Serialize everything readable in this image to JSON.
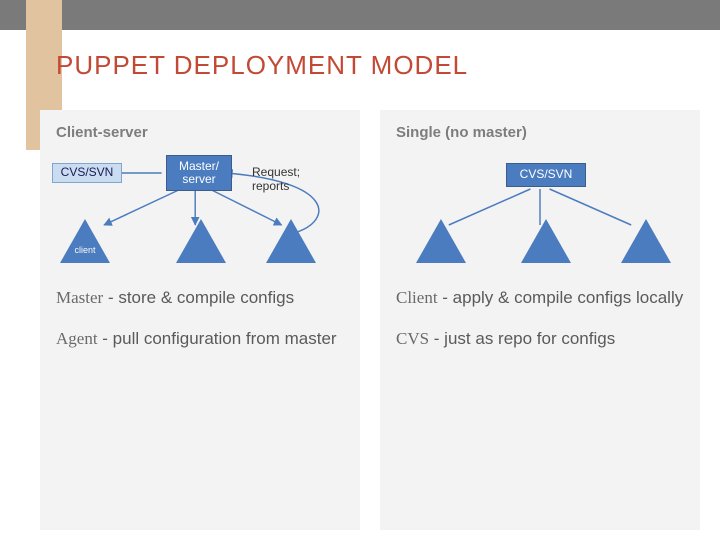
{
  "title": "PUPPET DEPLOYMENT MODEL",
  "left": {
    "heading": "Client-server",
    "cvs_label": "CVS/SVN",
    "master_label": "Master/\nserver",
    "annotation": "Request;\nreports",
    "client_label": "client",
    "desc1_term": "Master",
    "desc1_rest": " - store & compile configs",
    "desc2_term": "Agent",
    "desc2_rest": " - pull configuration        from master"
  },
  "right": {
    "heading": "Single (no master)",
    "cvs_label": "CVS/SVN",
    "desc1_term": "Client",
    "desc1_rest": " - apply & compile configs locally",
    "desc2_term": "CVS",
    "desc2_rest": "   - just as repo for configs"
  }
}
